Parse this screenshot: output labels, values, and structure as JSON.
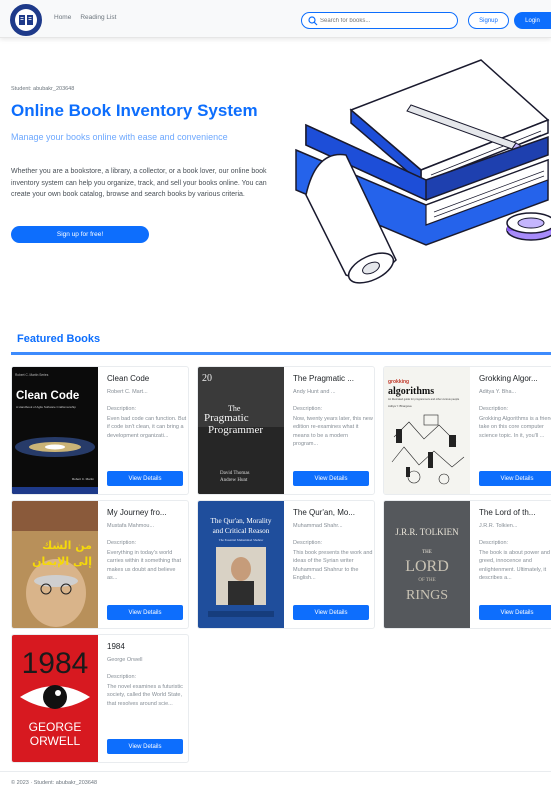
{
  "nav": {
    "logo_icon": "book-logo-icon",
    "links": [
      "Home",
      "Reading List"
    ],
    "search_placeholder": "Search for books...",
    "signup_label": "Signup",
    "login_label": "Login"
  },
  "hero": {
    "student": "Student: abubakr_203648",
    "title": "Online Book Inventory System",
    "subtitle": "Manage your books online with ease and convenience",
    "description": "Whether you are a bookstore, a library, a collector, or a book lover, our online book inventory system can help you organize, track, and sell your books online. You can create your own book catalog, browse and search books by various criteria.",
    "cta_label": "Sign up for free!"
  },
  "featured": {
    "title": "Featured Books",
    "description_label": "Description:",
    "button_label": "View Details",
    "books": [
      {
        "title": "Clean Code",
        "author": "Robert C. Mart...",
        "description": "Even bad code can function. But if code isn't clean, it can bring a development organizati...",
        "cover_title": "Clean Code",
        "cover_top": "Robert C. Martin Series",
        "cover_sub": "A Handbook of Agile Software Craftsmanship",
        "cover_author": "Robert C. Martin"
      },
      {
        "title": "The Pragmatic ...",
        "author": "Andy Hunt and ...",
        "description": "Now, twenty years later, this new edition re-examines what it means to be a modern program...",
        "cover_edition": "20",
        "cover_title_1": "The",
        "cover_title_2": "Pragmatic",
        "cover_title_3": "Programmer",
        "cover_author_1": "David Thomas",
        "cover_author_2": "Andrew Hunt"
      },
      {
        "title": "Grokking Algor...",
        "author": "Aditya Y. Bha...",
        "description": "Grokking Algorithms is a friendly take on this core computer science topic. In it, you'll ...",
        "cover_brand": "grokking",
        "cover_title": "algorithms",
        "cover_sub": "An illustrated guide for programmers and other curious people",
        "cover_author": "Aditya Y. Bhargava"
      },
      {
        "title": "My Journey fro...",
        "author": "Mustafa Mahmou...",
        "description": "Everything in today's world carries within it something that makes us doubt and believe as...",
        "cover_title_1": "من الشك",
        "cover_title_2": "إلى الإيمان"
      },
      {
        "title": "The Qur'an, Mo...",
        "author": "Muhammad Shahr...",
        "description": "This book presents the work and ideas of the Syrian writer Muhammad Shahrur to the English...",
        "cover_title_1": "The Qur'an, Morality",
        "cover_title_2": "and Critical Reason",
        "cover_sub": "The Essential Muhammad Shahrur"
      },
      {
        "title": "The Lord of th...",
        "author": "J.R.R. Tolkien...",
        "description": "The book is about power and greed, innocence and enlightenment. Ultimately, it describes a...",
        "cover_author": "J.R.R. TOLKIEN",
        "cover_title_1": "THE",
        "cover_title_2": "LORD",
        "cover_title_3": "OF THE",
        "cover_title_4": "RINGS"
      },
      {
        "title": "1984",
        "author": "George Orwell",
        "description": "The novel examines a futuristic society, called the World State, that resolves around scie...",
        "cover_title": "1984",
        "cover_author_1": "GEORGE",
        "cover_author_2": "ORWELL"
      }
    ]
  },
  "footer": {
    "text": "© 2023 · Student: abubakr_203648"
  },
  "colors": {
    "primary": "#0d6efd",
    "subtitle": "#6ea8fe",
    "navbar_bg": "#f8f9fa"
  }
}
